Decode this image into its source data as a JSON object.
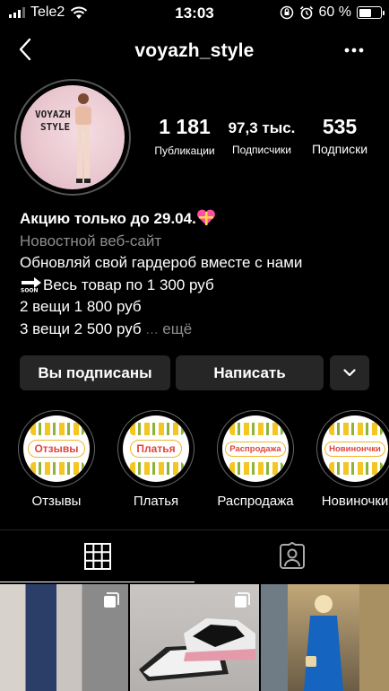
{
  "status_bar": {
    "carrier": "Tele2",
    "time": "13:03",
    "battery_percent": "60 %",
    "battery_level": 0.6
  },
  "header": {
    "username": "voyazh_style"
  },
  "profile": {
    "avatar_text_line1": "VOYAZH",
    "avatar_text_line2": "STYLE",
    "stats": {
      "posts_count": "1 181",
      "posts_label": "Публикации",
      "followers_count": "97,3 тыс.",
      "followers_label": "Подписчики",
      "following_count": "535",
      "following_label": "Подписки"
    }
  },
  "bio": {
    "name": "Акцию только до 29.04.",
    "category": "Новостной веб-сайт",
    "line1": "Обновляй свой гардероб вместе с нами",
    "line2": "Весь товар по 1 300 руб",
    "line3": "2 вещи 1 800 руб",
    "line4": "3 вещи 2 500 руб",
    "ellipsis": "...",
    "more_link": "ещё"
  },
  "buttons": {
    "subscribed": "Вы подписаны",
    "message": "Написать"
  },
  "highlights": [
    {
      "tag": "Отзывы",
      "label": "Отзывы"
    },
    {
      "tag": "Платья",
      "label": "Платья"
    },
    {
      "tag": "Распродажа",
      "label": "Распродажа"
    },
    {
      "tag": "Новинончки",
      "label": "Новиночки"
    }
  ],
  "colors": {
    "background": "#000000",
    "button_bg": "#262626",
    "secondary_text": "#8e8e8e"
  }
}
